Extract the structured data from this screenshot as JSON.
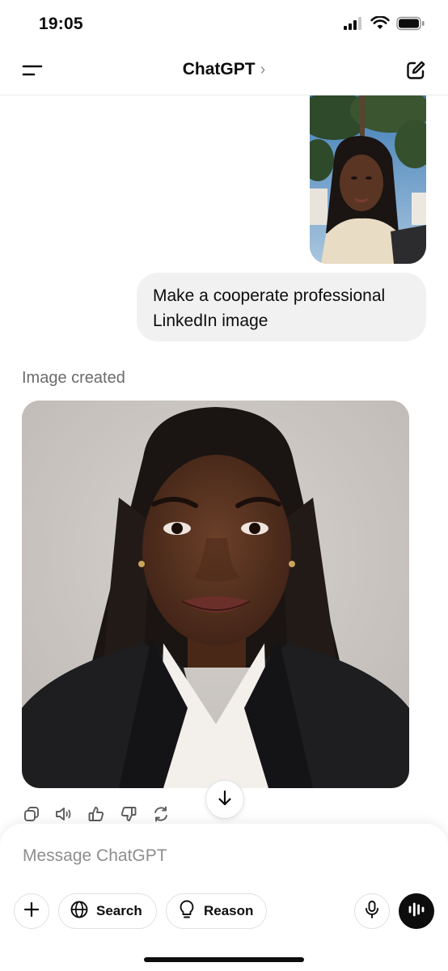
{
  "status_bar": {
    "time": "19:05"
  },
  "header": {
    "title": "ChatGPT",
    "title_chevron": "›"
  },
  "messages": {
    "user_text": "Make a cooperate professional LinkedIn image",
    "assistant_label": "Image created"
  },
  "composer": {
    "placeholder": "Message ChatGPT",
    "search_label": "Search",
    "reason_label": "Reason"
  },
  "icons": [
    "signal-icon",
    "wifi-icon",
    "battery-icon",
    "menu-icon",
    "new-chat-icon",
    "copy-icon",
    "read-aloud-icon",
    "thumbs-up-icon",
    "thumbs-down-icon",
    "regenerate-icon",
    "arrow-down-icon",
    "plus-icon",
    "globe-icon",
    "lightbulb-icon",
    "mic-icon",
    "voice-wave-icon"
  ],
  "colors": {
    "bubble": "#f1f1f1",
    "text": "#0d0d0d",
    "muted": "#8e8e8e"
  }
}
